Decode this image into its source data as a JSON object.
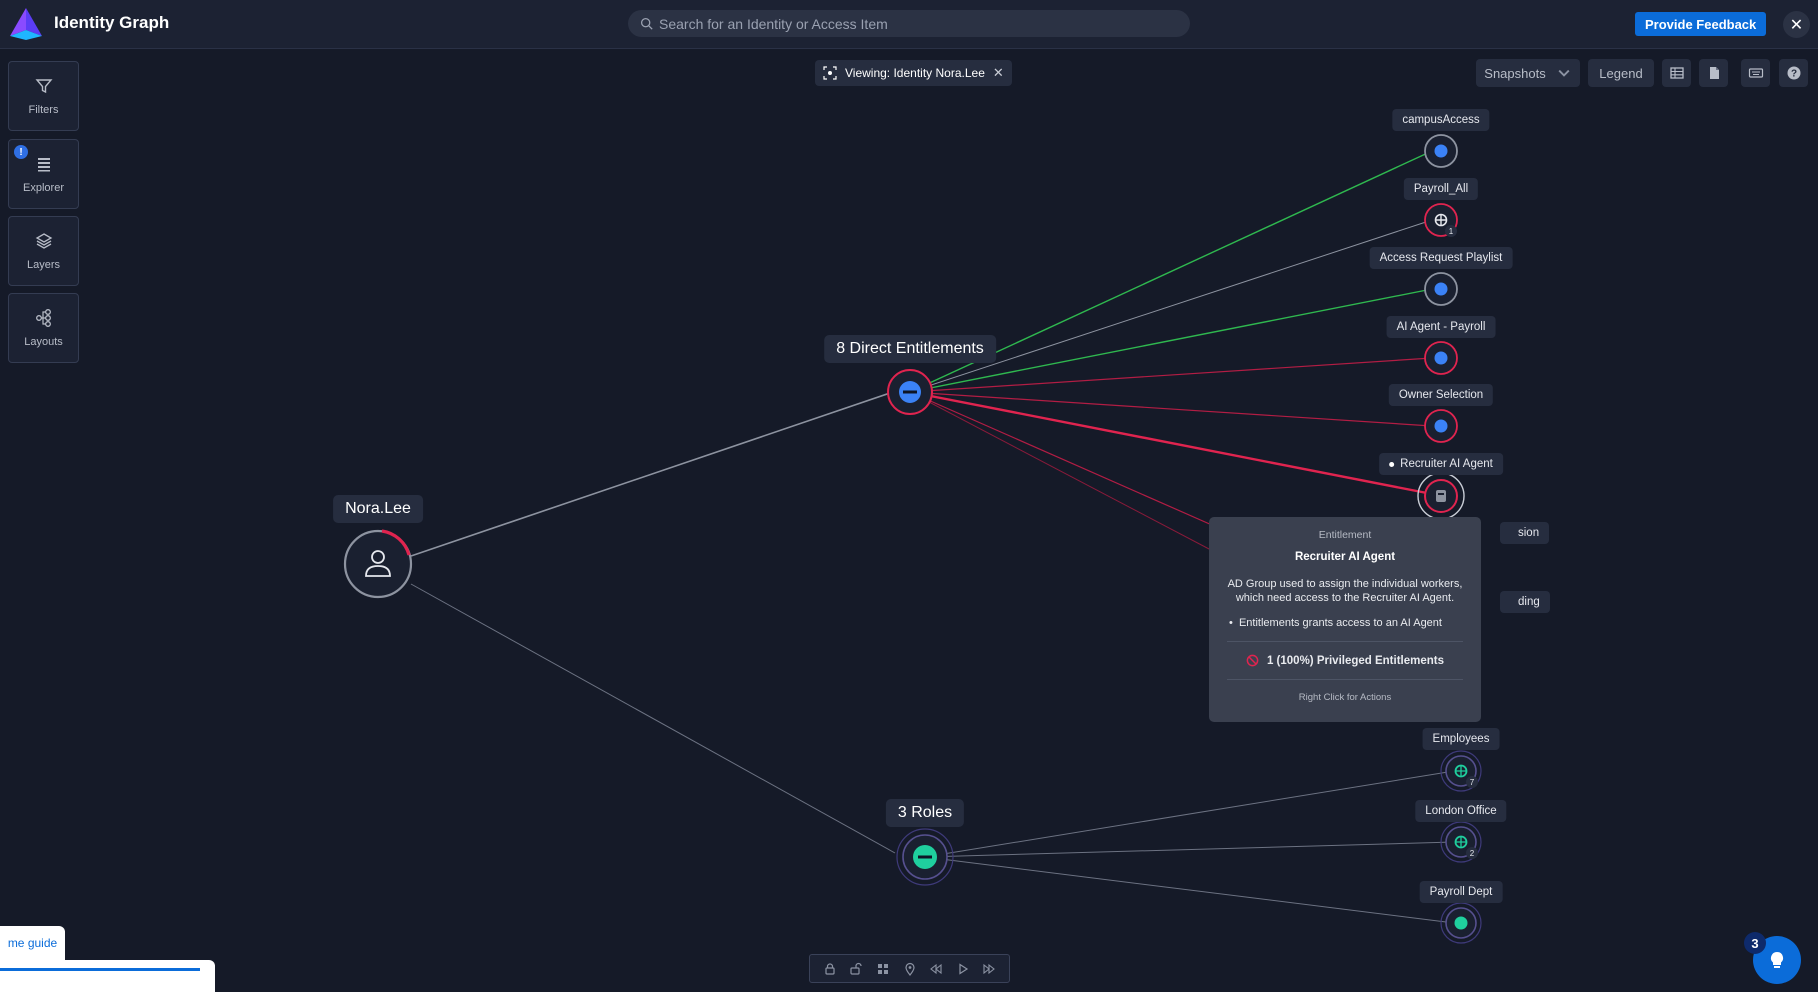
{
  "header": {
    "app_title": "Identity Graph",
    "search_placeholder": "Search for an Identity or Access Item",
    "feedback_label": "Provide Feedback"
  },
  "left_toolbar": {
    "filters": "Filters",
    "explorer": "Explorer",
    "explorer_badge": "!",
    "layers": "Layers",
    "layouts": "Layouts"
  },
  "viewing": {
    "label": "Viewing: Identity Nora.Lee"
  },
  "top_controls": {
    "snapshots": "Snapshots",
    "legend": "Legend"
  },
  "graph": {
    "identity": "Nora.Lee",
    "groups": {
      "entitlements": "8 Direct Entitlements",
      "roles": "3 Roles"
    },
    "entitlements": [
      "campusAccess",
      "Payroll_All",
      "Access Request Playlist",
      "AI Agent - Payroll",
      "Owner Selection",
      "Recruiter AI Agent",
      "sion",
      "ding"
    ],
    "payroll_count": "1",
    "roles": [
      "Employees",
      "London Office",
      "Payroll Dept"
    ],
    "role_counts": [
      "7",
      "2"
    ]
  },
  "tooltip": {
    "type": "Entitlement",
    "name": "Recruiter AI Agent",
    "description": "AD Group used to assign the individual workers, which need access to the Recruiter AI Agent.",
    "bullet": "Entitlements grants access to an AI Agent",
    "privileged": "1 (100%) Privileged Entitlements",
    "hint": "Right Click for Actions"
  },
  "guide": {
    "tab_label": "me guide"
  },
  "help": {
    "count": "3"
  },
  "colors": {
    "background": "#151a28",
    "accent": "#0b6cd9",
    "privileged": "#e0244f",
    "green_edge": "#2fb84f",
    "role_teal": "#1fcf9e",
    "entitlement_blue": "#3b82f6"
  }
}
